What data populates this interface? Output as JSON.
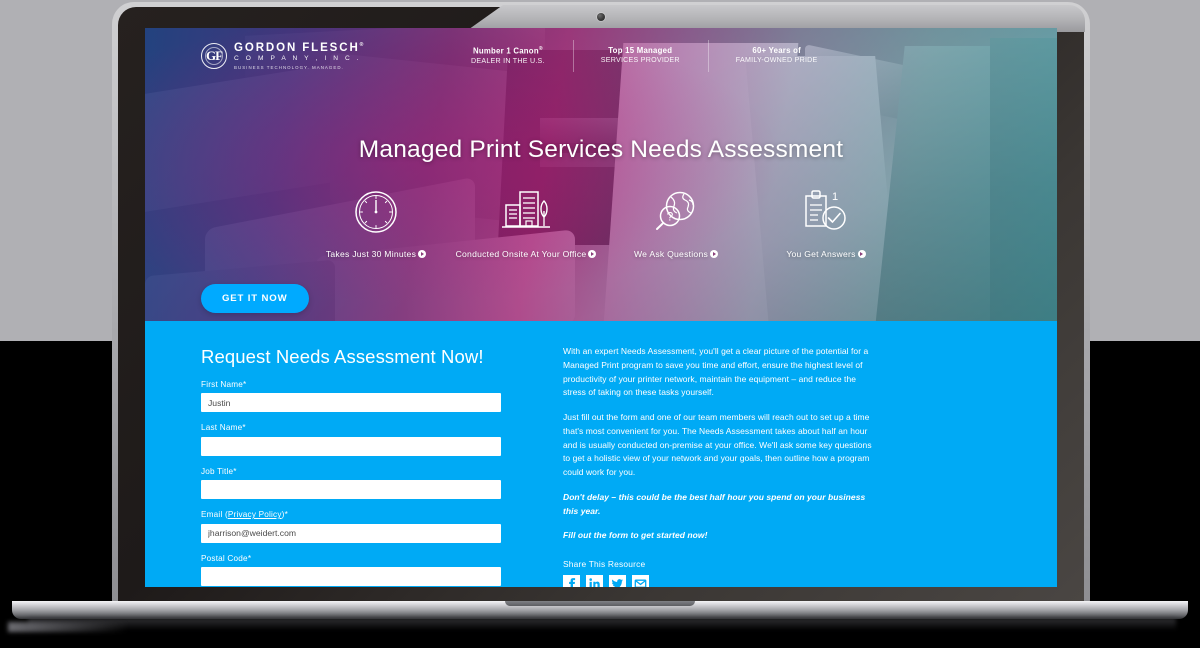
{
  "device": {
    "name": "laptop-mockup",
    "webcam": "webcam-dot"
  },
  "page": {
    "hero": {
      "logo": {
        "mark": "GF",
        "line1": "GORDON FLESCH",
        "line1_sup": "®",
        "line2": "C O M P A N Y ,  I N C .",
        "line3": "BUSINESS TECHNOLOGY. MANAGED."
      },
      "stats": [
        {
          "top": "Number 1 Canon",
          "sup": "®",
          "sub": "DEALER IN THE U.S."
        },
        {
          "top": "Top 15 Managed",
          "sub": "SERVICES PROVIDER"
        },
        {
          "top": "60+ Years of",
          "sub": "FAMILY-OWNED PRIDE"
        }
      ],
      "title": "Managed Print Services Needs Assessment",
      "benefits": [
        {
          "icon": "clock-icon",
          "label": "Takes Just 30 Minutes"
        },
        {
          "icon": "building-icon",
          "label": "Conducted Onsite At Your Office"
        },
        {
          "icon": "globe-question-icon",
          "label": "We Ask Questions"
        },
        {
          "icon": "checklist-icon",
          "label": "You Get Answers"
        }
      ],
      "cta_label": "GET IT NOW"
    },
    "form": {
      "title": "Request Needs Assessment Now!",
      "fields": [
        {
          "label": "First Name",
          "required": "*",
          "value": "Justin",
          "placeholder": ""
        },
        {
          "label": "Last Name",
          "required": "*",
          "value": "",
          "placeholder": ""
        },
        {
          "label": "Job Title",
          "required": "*",
          "value": "",
          "placeholder": ""
        },
        {
          "label": "Email ",
          "link": "Privacy Policy",
          "required": "*",
          "value": "jharrison@weidert.com",
          "placeholder": ""
        },
        {
          "label": "Postal Code",
          "required": "*",
          "value": "",
          "placeholder": ""
        }
      ]
    },
    "copy": {
      "p1": "With an expert Needs Assessment, you'll get a clear picture of the potential for a Managed Print program to save you time and effort, ensure the highest level of productivity of your printer network, maintain the equipment – and reduce the stress of taking on these tasks yourself.",
      "p2": "Just fill out the form and one of our team members will reach out to set up a time that's most convenient for you. The Needs Assessment takes about half an hour and is usually conducted on-premise at your office. We'll ask some key questions to get a holistic view of your network and your goals, then outline how a program could work for you.",
      "p3": "Don't delay – this could be the best half hour you spend on your business this year.",
      "p4": "Fill out the form to get started now!"
    },
    "share": {
      "title": "Share This Resource",
      "items": [
        {
          "icon": "facebook-icon",
          "name": "Facebook"
        },
        {
          "icon": "linkedin-icon",
          "name": "LinkedIn"
        },
        {
          "icon": "twitter-icon",
          "name": "Twitter"
        },
        {
          "icon": "email-icon",
          "name": "Email"
        }
      ]
    },
    "colors": {
      "brand_blue": "#00aaf5",
      "cta_blue": "#00aaff",
      "white": "#ffffff",
      "page_bg_top": "#b0b0b4",
      "page_bg_bottom": "#000000",
      "bezel": "#231f1e"
    }
  }
}
